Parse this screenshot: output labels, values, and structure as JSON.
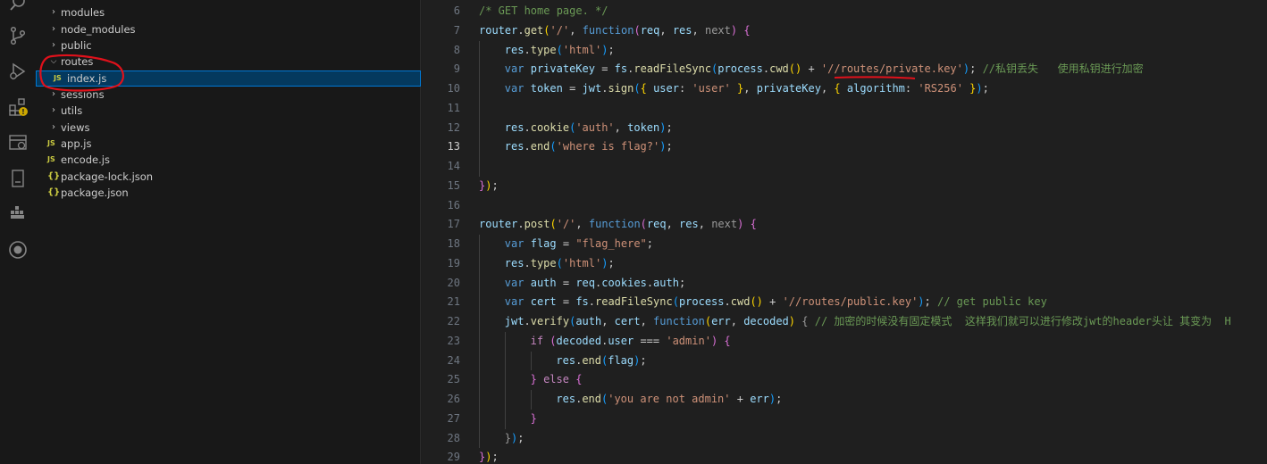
{
  "activity_bar": {
    "icons": [
      "search-icon",
      "source-control-icon",
      "run-debug-icon",
      "extensions-icon",
      "remote-explorer-icon",
      "bookmark-icon",
      "docker-icon",
      "github-icon"
    ]
  },
  "explorer": {
    "items": [
      {
        "label": "modules",
        "type": "folder",
        "expanded": false
      },
      {
        "label": "node_modules",
        "type": "folder",
        "expanded": false
      },
      {
        "label": "public",
        "type": "folder",
        "expanded": false
      },
      {
        "label": "routes",
        "type": "folder",
        "expanded": true
      },
      {
        "label": "index.js",
        "type": "js",
        "icon_text": "JS",
        "selected": true
      },
      {
        "label": "sessions",
        "type": "folder",
        "expanded": false
      },
      {
        "label": "utils",
        "type": "folder",
        "expanded": false
      },
      {
        "label": "views",
        "type": "folder",
        "expanded": false
      },
      {
        "label": "app.js",
        "type": "js",
        "icon_text": "JS"
      },
      {
        "label": "encode.js",
        "type": "js",
        "icon_text": "JS"
      },
      {
        "label": "package-lock.json",
        "type": "json",
        "icon_text": "{}"
      },
      {
        "label": "package.json",
        "type": "json",
        "icon_text": "{}"
      }
    ]
  },
  "editor": {
    "active_line": 13,
    "lines": [
      {
        "n": 6,
        "indent": 0,
        "tokens": [
          [
            "/* GET home page. */",
            "c-comment"
          ]
        ]
      },
      {
        "n": 7,
        "indent": 0,
        "tokens": [
          [
            "router",
            "c-var"
          ],
          [
            ".",
            "c-def"
          ],
          [
            "get",
            "c-fn"
          ],
          [
            "(",
            "c-p1"
          ],
          [
            "'/'",
            "c-str"
          ],
          [
            ", ",
            "c-def"
          ],
          [
            "function",
            "c-kw"
          ],
          [
            "(",
            "c-p2"
          ],
          [
            "req",
            "c-param"
          ],
          [
            ", ",
            "c-def"
          ],
          [
            "res",
            "c-param"
          ],
          [
            ", ",
            "c-def"
          ],
          [
            "next",
            "c-muted"
          ],
          [
            ")",
            "c-p2"
          ],
          [
            " ",
            "c-def"
          ],
          [
            "{",
            "c-p2"
          ]
        ]
      },
      {
        "n": 8,
        "indent": 1,
        "tokens": [
          [
            "res",
            "c-var"
          ],
          [
            ".",
            "c-def"
          ],
          [
            "type",
            "c-fn"
          ],
          [
            "(",
            "c-p3"
          ],
          [
            "'html'",
            "c-str"
          ],
          [
            ")",
            "c-p3"
          ],
          [
            ";",
            "c-def"
          ]
        ]
      },
      {
        "n": 9,
        "indent": 1,
        "tokens": [
          [
            "var",
            "c-kw"
          ],
          [
            " ",
            "c-def"
          ],
          [
            "privateKey",
            "c-var"
          ],
          [
            " = ",
            "c-def"
          ],
          [
            "fs",
            "c-var"
          ],
          [
            ".",
            "c-def"
          ],
          [
            "readFileSync",
            "c-fn"
          ],
          [
            "(",
            "c-p3"
          ],
          [
            "process",
            "c-var"
          ],
          [
            ".",
            "c-def"
          ],
          [
            "cwd",
            "c-fn"
          ],
          [
            "()",
            "c-p1"
          ],
          [
            " + ",
            "c-def"
          ],
          [
            "'//routes/private.key'",
            "c-str"
          ],
          [
            ")",
            "c-p3"
          ],
          [
            "; ",
            "c-def"
          ],
          [
            "//私钥丢失   使用私钥进行加密",
            "c-comment"
          ]
        ]
      },
      {
        "n": 10,
        "indent": 1,
        "tokens": [
          [
            "var",
            "c-kw"
          ],
          [
            " ",
            "c-def"
          ],
          [
            "token",
            "c-var"
          ],
          [
            " = ",
            "c-def"
          ],
          [
            "jwt",
            "c-var"
          ],
          [
            ".",
            "c-def"
          ],
          [
            "sign",
            "c-fn"
          ],
          [
            "(",
            "c-p3"
          ],
          [
            "{",
            "c-p1"
          ],
          [
            " ",
            "c-def"
          ],
          [
            "user",
            "c-var"
          ],
          [
            ": ",
            "c-def"
          ],
          [
            "'user'",
            "c-str"
          ],
          [
            " ",
            "c-def"
          ],
          [
            "}",
            "c-p1"
          ],
          [
            ", ",
            "c-def"
          ],
          [
            "privateKey",
            "c-var"
          ],
          [
            ", ",
            "c-def"
          ],
          [
            "{",
            "c-p1"
          ],
          [
            " ",
            "c-def"
          ],
          [
            "algorithm",
            "c-var"
          ],
          [
            ": ",
            "c-def"
          ],
          [
            "'RS256'",
            "c-str"
          ],
          [
            " ",
            "c-def"
          ],
          [
            "}",
            "c-p1"
          ],
          [
            ")",
            "c-p3"
          ],
          [
            ";",
            "c-def"
          ]
        ]
      },
      {
        "n": 11,
        "indent": 1,
        "tokens": []
      },
      {
        "n": 12,
        "indent": 1,
        "tokens": [
          [
            "res",
            "c-var"
          ],
          [
            ".",
            "c-def"
          ],
          [
            "cookie",
            "c-fn"
          ],
          [
            "(",
            "c-p3"
          ],
          [
            "'auth'",
            "c-str"
          ],
          [
            ", ",
            "c-def"
          ],
          [
            "token",
            "c-var"
          ],
          [
            ")",
            "c-p3"
          ],
          [
            ";",
            "c-def"
          ]
        ]
      },
      {
        "n": 13,
        "indent": 1,
        "tokens": [
          [
            "res",
            "c-var"
          ],
          [
            ".",
            "c-def"
          ],
          [
            "end",
            "c-fn"
          ],
          [
            "(",
            "c-p3"
          ],
          [
            "'where is flag?'",
            "c-str"
          ],
          [
            ")",
            "c-p3"
          ],
          [
            ";",
            "c-def"
          ]
        ]
      },
      {
        "n": 14,
        "indent": 1,
        "tokens": []
      },
      {
        "n": 15,
        "indent": 0,
        "tokens": [
          [
            "}",
            "c-p2"
          ],
          [
            ")",
            "c-p1"
          ],
          [
            ";",
            "c-def"
          ]
        ]
      },
      {
        "n": 16,
        "indent": 0,
        "tokens": []
      },
      {
        "n": 17,
        "indent": 0,
        "tokens": [
          [
            "router",
            "c-var"
          ],
          [
            ".",
            "c-def"
          ],
          [
            "post",
            "c-fn"
          ],
          [
            "(",
            "c-p1"
          ],
          [
            "'/'",
            "c-str"
          ],
          [
            ", ",
            "c-def"
          ],
          [
            "function",
            "c-kw"
          ],
          [
            "(",
            "c-p2"
          ],
          [
            "req",
            "c-param"
          ],
          [
            ", ",
            "c-def"
          ],
          [
            "res",
            "c-param"
          ],
          [
            ", ",
            "c-def"
          ],
          [
            "next",
            "c-muted"
          ],
          [
            ")",
            "c-p2"
          ],
          [
            " ",
            "c-def"
          ],
          [
            "{",
            "c-p2"
          ]
        ]
      },
      {
        "n": 18,
        "indent": 1,
        "tokens": [
          [
            "var",
            "c-kw"
          ],
          [
            " ",
            "c-def"
          ],
          [
            "flag",
            "c-var"
          ],
          [
            " = ",
            "c-def"
          ],
          [
            "\"flag_here\"",
            "c-str"
          ],
          [
            ";",
            "c-def"
          ]
        ]
      },
      {
        "n": 19,
        "indent": 1,
        "tokens": [
          [
            "res",
            "c-var"
          ],
          [
            ".",
            "c-def"
          ],
          [
            "type",
            "c-fn"
          ],
          [
            "(",
            "c-p3"
          ],
          [
            "'html'",
            "c-str"
          ],
          [
            ")",
            "c-p3"
          ],
          [
            ";",
            "c-def"
          ]
        ]
      },
      {
        "n": 20,
        "indent": 1,
        "tokens": [
          [
            "var",
            "c-kw"
          ],
          [
            " ",
            "c-def"
          ],
          [
            "auth",
            "c-var"
          ],
          [
            " = ",
            "c-def"
          ],
          [
            "req",
            "c-var"
          ],
          [
            ".",
            "c-def"
          ],
          [
            "cookies",
            "c-var"
          ],
          [
            ".",
            "c-def"
          ],
          [
            "auth",
            "c-var"
          ],
          [
            ";",
            "c-def"
          ]
        ]
      },
      {
        "n": 21,
        "indent": 1,
        "tokens": [
          [
            "var",
            "c-kw"
          ],
          [
            " ",
            "c-def"
          ],
          [
            "cert",
            "c-var"
          ],
          [
            " = ",
            "c-def"
          ],
          [
            "fs",
            "c-var"
          ],
          [
            ".",
            "c-def"
          ],
          [
            "readFileSync",
            "c-fn"
          ],
          [
            "(",
            "c-p3"
          ],
          [
            "process",
            "c-var"
          ],
          [
            ".",
            "c-def"
          ],
          [
            "cwd",
            "c-fn"
          ],
          [
            "()",
            "c-p1"
          ],
          [
            " + ",
            "c-def"
          ],
          [
            "'//routes/public.key'",
            "c-str"
          ],
          [
            ")",
            "c-p3"
          ],
          [
            "; ",
            "c-def"
          ],
          [
            "// get public key",
            "c-comment"
          ]
        ]
      },
      {
        "n": 22,
        "indent": 1,
        "tokens": [
          [
            "jwt",
            "c-var"
          ],
          [
            ".",
            "c-def"
          ],
          [
            "verify",
            "c-fn"
          ],
          [
            "(",
            "c-p3"
          ],
          [
            "auth",
            "c-var"
          ],
          [
            ", ",
            "c-def"
          ],
          [
            "cert",
            "c-var"
          ],
          [
            ", ",
            "c-def"
          ],
          [
            "function",
            "c-kw"
          ],
          [
            "(",
            "c-p1"
          ],
          [
            "err",
            "c-param"
          ],
          [
            ", ",
            "c-def"
          ],
          [
            "decoded",
            "c-param"
          ],
          [
            ")",
            "c-p1"
          ],
          [
            " ",
            "c-def"
          ],
          [
            "{",
            "c-muted"
          ],
          [
            " ",
            "c-def"
          ],
          [
            "// 加密的时候没有固定模式  这样我们就可以进行修改jwt的header头让 其变为  H",
            "c-comment"
          ]
        ]
      },
      {
        "n": 23,
        "indent": 2,
        "tokens": [
          [
            "if",
            "c-ctrl"
          ],
          [
            " ",
            "c-def"
          ],
          [
            "(",
            "c-p2"
          ],
          [
            "decoded",
            "c-var"
          ],
          [
            ".",
            "c-def"
          ],
          [
            "user",
            "c-var"
          ],
          [
            " === ",
            "c-def"
          ],
          [
            "'admin'",
            "c-str"
          ],
          [
            ")",
            "c-p2"
          ],
          [
            " ",
            "c-def"
          ],
          [
            "{",
            "c-p2"
          ]
        ]
      },
      {
        "n": 24,
        "indent": 3,
        "tokens": [
          [
            "res",
            "c-var"
          ],
          [
            ".",
            "c-def"
          ],
          [
            "end",
            "c-fn"
          ],
          [
            "(",
            "c-p3"
          ],
          [
            "flag",
            "c-var"
          ],
          [
            ")",
            "c-p3"
          ],
          [
            ";",
            "c-def"
          ]
        ]
      },
      {
        "n": 25,
        "indent": 2,
        "tokens": [
          [
            "}",
            "c-p2"
          ],
          [
            " ",
            "c-def"
          ],
          [
            "else",
            "c-ctrl"
          ],
          [
            " ",
            "c-def"
          ],
          [
            "{",
            "c-p2"
          ]
        ]
      },
      {
        "n": 26,
        "indent": 3,
        "tokens": [
          [
            "res",
            "c-var"
          ],
          [
            ".",
            "c-def"
          ],
          [
            "end",
            "c-fn"
          ],
          [
            "(",
            "c-p3"
          ],
          [
            "'you are not admin'",
            "c-str"
          ],
          [
            " + ",
            "c-def"
          ],
          [
            "err",
            "c-var"
          ],
          [
            ")",
            "c-p3"
          ],
          [
            ";",
            "c-def"
          ]
        ]
      },
      {
        "n": 27,
        "indent": 2,
        "tokens": [
          [
            "}",
            "c-p2"
          ]
        ]
      },
      {
        "n": 28,
        "indent": 1,
        "tokens": [
          [
            "}",
            "c-muted"
          ],
          [
            ")",
            "c-p3"
          ],
          [
            ";",
            "c-def"
          ]
        ]
      },
      {
        "n": 29,
        "indent": 0,
        "tokens": [
          [
            "}",
            "c-p2"
          ],
          [
            ")",
            "c-p1"
          ],
          [
            ";",
            "c-def"
          ]
        ]
      }
    ]
  },
  "colors": {
    "annotation": "#e0111b",
    "selection_bg": "#04395e",
    "selection_border": "#0078d4"
  }
}
